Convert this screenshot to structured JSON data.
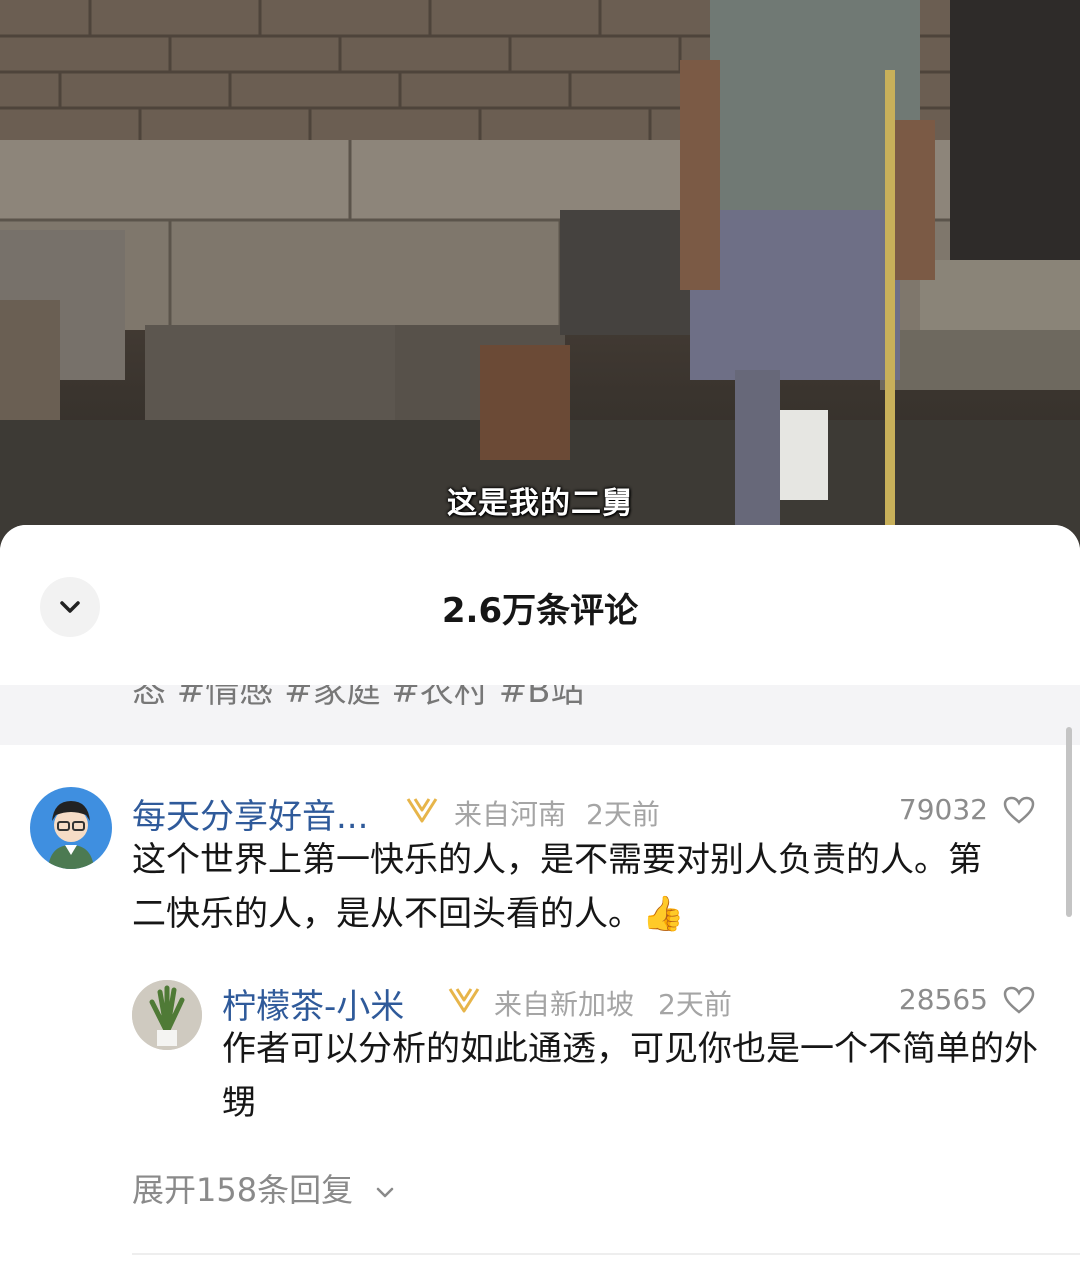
{
  "video": {
    "subtitle": "这是我的二舅"
  },
  "sheet": {
    "title": "2.6万条评论",
    "description_tail": "态 #情感 #家庭 #农村 #B站"
  },
  "comments": [
    {
      "username": "每天分享好音...",
      "location": "来自河南",
      "time": "2天前",
      "likes": "79032",
      "text": "这个世界上第一快乐的人，是不需要对别人负责的人。第二快乐的人，是从不回头看的人。",
      "emoji": "👍",
      "replies": [
        {
          "username": "柠檬茶-小米",
          "location": "来自新加坡",
          "time": "2天前",
          "likes": "28565",
          "text": "作者可以分析的如此通透，可见你也是一个不简单的外甥"
        }
      ],
      "expand_label": "展开158条回复"
    }
  ],
  "colors": {
    "username": "#2f5a9a",
    "vip": "#e7b54a",
    "meta": "#a5a5a5"
  },
  "icons": [
    "chevron-down-icon",
    "vip-badge-icon",
    "heart-icon",
    "thumbs-up-icon"
  ]
}
